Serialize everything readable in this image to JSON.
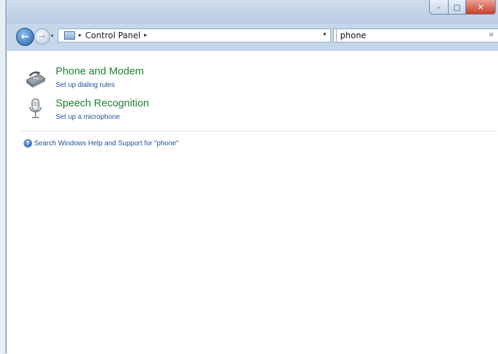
{
  "window": {
    "title": "",
    "buttons": {
      "minimize": "–",
      "maximize": "□",
      "close": "✕"
    }
  },
  "nav": {
    "back_glyph": "←",
    "forward_glyph": "→",
    "recent_glyph": "▾",
    "breadcrumb": [
      "Control Panel"
    ],
    "separator_glyph": "▸",
    "address_dropdown_glyph": "▾",
    "refresh_glyph": "↻",
    "search_value": "phone",
    "search_clear_glyph": "×"
  },
  "results": [
    {
      "title": "Phone and Modem",
      "subtitle": "Set up dialing rules",
      "icon": "phone-modem-icon"
    },
    {
      "title": "Speech Recognition",
      "subtitle": "Set up a microphone",
      "icon": "microphone-icon"
    }
  ],
  "help": {
    "icon": "help-icon",
    "glyph": "?",
    "text": "Search Windows Help and Support for \"phone\""
  },
  "colors": {
    "result_title": "#1e7e2e",
    "link": "#1f4f9e",
    "close_button": "#c8402a"
  }
}
